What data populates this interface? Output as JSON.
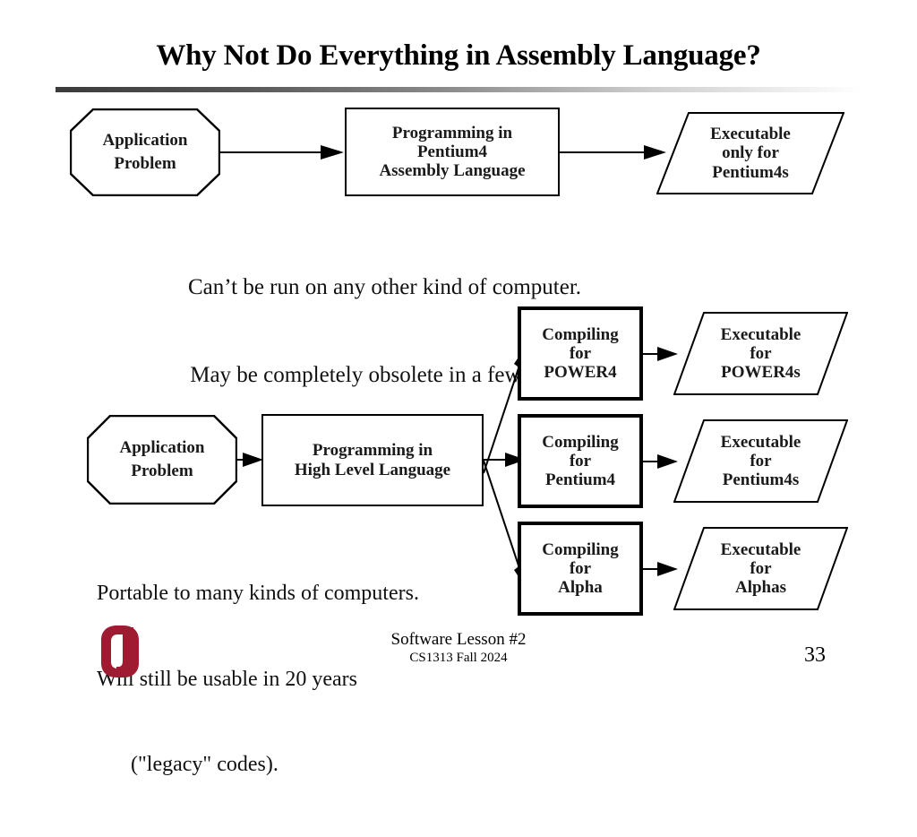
{
  "slide": {
    "title": "Why Not Do Everything in Assembly Language?",
    "page_number": "33",
    "accent_color": "#9E1B32",
    "line_color": "#000000"
  },
  "diagram_top": {
    "nodes": {
      "application_problem": {
        "line1": "Application",
        "line2": "Problem"
      },
      "assembly_programming": {
        "line1": "Programming in",
        "line2": "Pentium4",
        "line3": "Assembly Language"
      },
      "executable_pentium": {
        "line1": "Executable",
        "line2": "only for",
        "line3": "Pentium4s"
      }
    }
  },
  "caption_top": {
    "line1": "Can’t be run on any other kind of computer.",
    "line2": "May be completely obsolete in a few years."
  },
  "diagram_bottom": {
    "nodes": {
      "application_problem": {
        "line1": "Application",
        "line2": "Problem"
      },
      "hll_programming": {
        "line1": "Programming in",
        "line2": "High Level Language"
      },
      "compiling_power4": {
        "line1": "Compiling",
        "line2": "for",
        "line3": "POWER4"
      },
      "compiling_pentium4": {
        "line1": "Compiling",
        "line2": "for",
        "line3": "Pentium4"
      },
      "compiling_alpha": {
        "line1": "Compiling",
        "line2": "for",
        "line3": "Alpha"
      },
      "executable_power4": {
        "line1": "Executable",
        "line2": "for",
        "line3": "POWER4s"
      },
      "executable_pentium4": {
        "line1": "Executable",
        "line2": "for",
        "line3": "Pentium4s"
      },
      "executable_alpha": {
        "line1": "Executable",
        "line2": "for",
        "line3": "Alphas"
      }
    }
  },
  "caption_bottom": {
    "line1": "Portable to many kinds of computers.",
    "line2": "Will still be usable in 20 years",
    "line3": "(\"legacy\" codes)."
  },
  "footer": {
    "lesson": "Software Lesson #2",
    "course": "CS1313 Fall 2024",
    "logo_alt": "ou-logo"
  }
}
